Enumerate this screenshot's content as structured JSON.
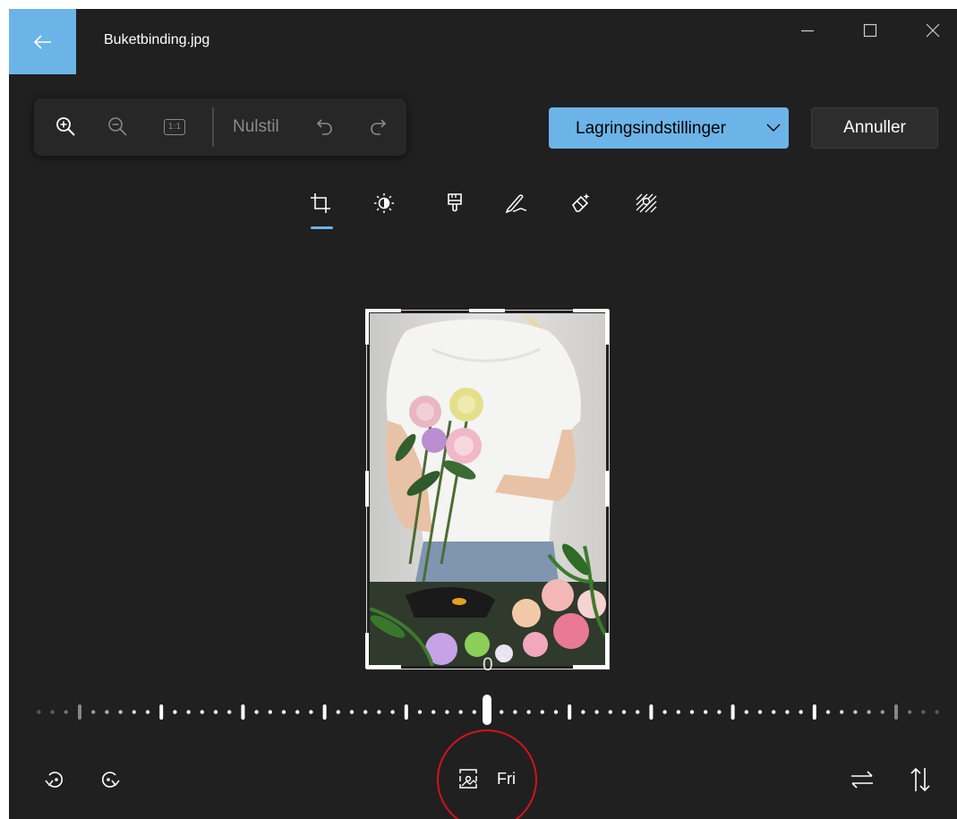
{
  "window": {
    "title": "Buketbinding.jpg",
    "accent_color": "#6cb4e8",
    "background_color": "#202020"
  },
  "title_bar": {
    "back_icon": "arrow-left-icon",
    "minimize_icon": "minimize-icon",
    "maximize_icon": "maximize-icon",
    "close_icon": "close-icon"
  },
  "toolbar": {
    "zoom_in_icon": "zoom-in-icon",
    "zoom_out_icon": "zoom-out-icon",
    "actual_size_label": "1:1",
    "reset_label": "Nulstil",
    "undo_icon": "undo-icon",
    "redo_icon": "redo-icon"
  },
  "actions": {
    "save_label": "Lagringsindstillinger",
    "cancel_label": "Annuller"
  },
  "tools": [
    {
      "icon": "crop-icon",
      "active": true
    },
    {
      "icon": "adjust-icon",
      "active": false
    },
    {
      "icon": "filter-brush-icon",
      "active": false
    },
    {
      "icon": "markup-pen-icon",
      "active": false
    },
    {
      "icon": "eraser-icon",
      "active": false
    },
    {
      "icon": "background-blur-icon",
      "active": false
    }
  ],
  "straighten": {
    "angle_label": "0 °",
    "value": 0
  },
  "bottom_bar": {
    "rotate_left_icon": "rotate-left-icon",
    "rotate_right_icon": "rotate-right-icon",
    "aspect_ratio_label": "Fri",
    "aspect_ratio_icon": "aspect-ratio-icon",
    "flip_horizontal_icon": "flip-horizontal-icon",
    "flip_vertical_icon": "flip-vertical-icon"
  }
}
